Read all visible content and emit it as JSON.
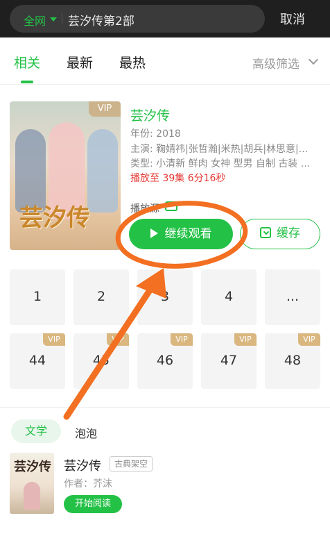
{
  "search": {
    "scope": "全网",
    "query": "芸汐传第2部",
    "cancel": "取消"
  },
  "tabs": {
    "items": [
      "相关",
      "最新",
      "最热"
    ],
    "filter": "高级筛选"
  },
  "result": {
    "badge": "VIP",
    "poster_title": "芸汐传",
    "title": "芸汐传",
    "year": "年份: 2018",
    "cast": "主演: 鞠婧祎|张哲瀚|米热|胡兵|林思意|...",
    "genre": "类型: 小清新 鲜肉 女神 型男 自制 古装 ...",
    "progress": "播放至 39集 6分16秒",
    "source_label": "播放源",
    "watch_button": "继续观看",
    "cache_button": "缓存"
  },
  "episodes": {
    "row1": [
      "1",
      "2",
      "3",
      "4",
      "..."
    ],
    "row2": [
      "44",
      "45",
      "46",
      "47",
      "48"
    ],
    "vip_label": "VIP"
  },
  "sections": {
    "active": "文学",
    "other": "泡泡"
  },
  "book": {
    "cover_title": "芸汐传",
    "title": "芸汐传",
    "tag": "古典架空",
    "author": "作者：芥沫",
    "read_button": "开始阅读"
  },
  "colors": {
    "accent": "#23c146",
    "annotation": "#f36f21",
    "alert": "#e53935"
  }
}
